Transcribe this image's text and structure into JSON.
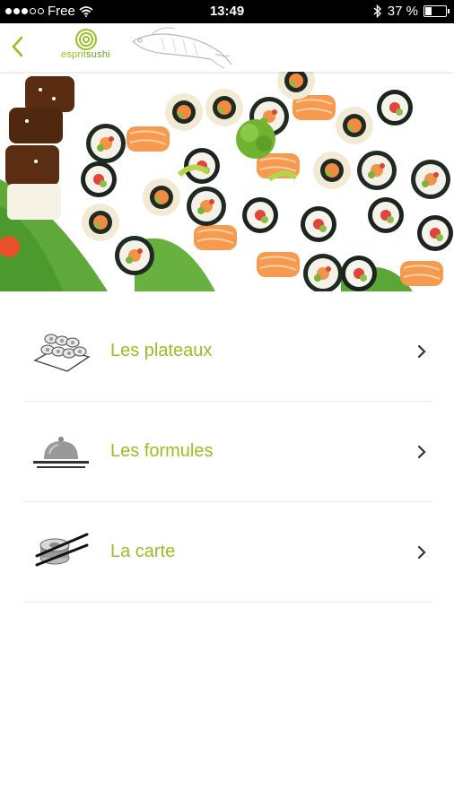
{
  "status_bar": {
    "carrier": "Free",
    "time": "13:49",
    "battery": "37 %",
    "battery_level": 0.37
  },
  "header": {
    "logo_text_left": "esprit",
    "logo_text_right": "sushi"
  },
  "menu": {
    "items": [
      {
        "label": "Les plateaux",
        "icon": "sushi-tray-icon"
      },
      {
        "label": "Les formules",
        "icon": "cloche-icon"
      },
      {
        "label": "La carte",
        "icon": "chopsticks-icon"
      }
    ]
  },
  "colors": {
    "accent": "#95c11f",
    "text_dark": "#333333"
  }
}
